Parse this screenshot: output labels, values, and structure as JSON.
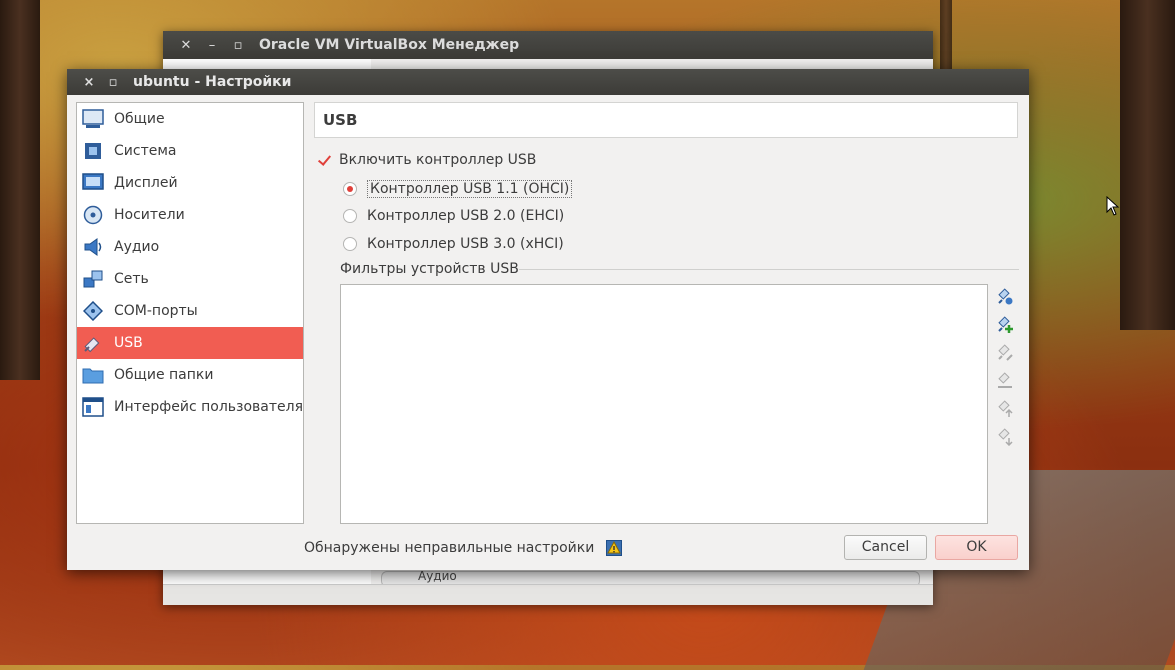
{
  "manager": {
    "title": "Oracle VM VirtualBox Менеджер",
    "bottom_text": "Аудио"
  },
  "dialog": {
    "title": "ubuntu - Настройки",
    "close_glyph": "×",
    "restore_glyph": "▫",
    "sidebar": {
      "items": [
        {
          "label": "Общие",
          "icon": "monitor-icon"
        },
        {
          "label": "Система",
          "icon": "chip-icon"
        },
        {
          "label": "Дисплей",
          "icon": "display-icon"
        },
        {
          "label": "Носители",
          "icon": "disk-icon"
        },
        {
          "label": "Аудио",
          "icon": "speaker-icon"
        },
        {
          "label": "Сеть",
          "icon": "network-icon"
        },
        {
          "label": "COM-порты",
          "icon": "serial-port-icon"
        },
        {
          "label": "USB",
          "icon": "usb-icon",
          "selected": true
        },
        {
          "label": "Общие папки",
          "icon": "folder-icon"
        },
        {
          "label": "Интерфейс пользователя",
          "icon": "window-icon"
        }
      ]
    },
    "page": {
      "header": "USB",
      "enable_label": "Включить контроллер USB",
      "enable_checked": true,
      "radios": [
        {
          "label": "Контроллер USB 1.1 (OHCI)",
          "checked": true
        },
        {
          "label": "Контроллер USB 2.0 (EHCI)",
          "checked": false
        },
        {
          "label": "Контроллер USB 3.0 (xHCI)",
          "checked": false
        }
      ],
      "filters_label": "Фильтры устройств USB",
      "filter_tools": [
        {
          "icon": "add-filter-icon",
          "enabled": true
        },
        {
          "icon": "add-from-device-icon",
          "enabled": true
        },
        {
          "icon": "edit-filter-icon",
          "enabled": false
        },
        {
          "icon": "remove-filter-icon",
          "enabled": false
        },
        {
          "icon": "move-up-icon",
          "enabled": false
        },
        {
          "icon": "move-down-icon",
          "enabled": false
        }
      ]
    },
    "footer": {
      "warning_text": "Обнаружены неправильные настройки",
      "cancel_label": "Cancel",
      "ok_label": "OK"
    }
  },
  "colors": {
    "accent": "#f15d52",
    "titlebar": "#3c3b37"
  }
}
